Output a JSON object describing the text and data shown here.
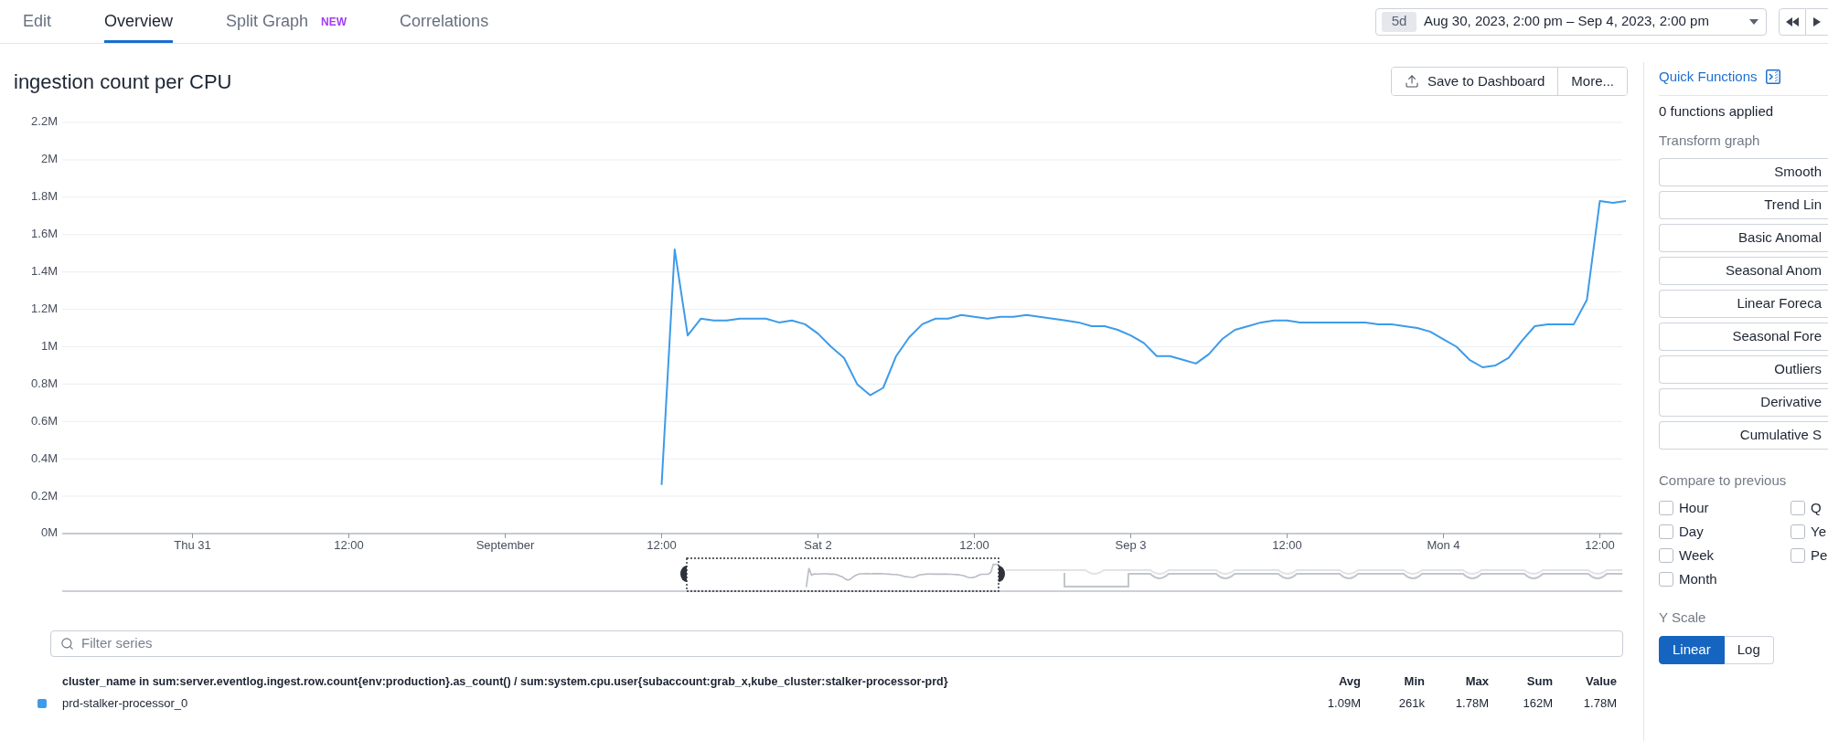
{
  "tabs": [
    {
      "label": "Edit",
      "selected": false
    },
    {
      "label": "Overview",
      "selected": true
    },
    {
      "label": "Split Graph",
      "badge": "NEW",
      "selected": false
    },
    {
      "label": "Correlations",
      "selected": false
    }
  ],
  "time_range": {
    "preset": "5d",
    "label": "Aug 30, 2023, 2:00 pm – Sep 4, 2023, 2:00 pm"
  },
  "graph": {
    "title": "ingestion count per CPU",
    "actions": [
      {
        "label": "Save to Dashboard",
        "kind": "export"
      },
      {
        "label": "More...",
        "kind": "menu"
      }
    ],
    "chart_data": {
      "type": "line",
      "grid": true,
      "ylim": [
        0,
        2.2
      ],
      "categories": [
        null,
        null,
        null,
        null,
        null,
        null,
        null,
        null,
        null,
        null,
        "Thu 31",
        null,
        null,
        null,
        null,
        null,
        null,
        null,
        null,
        null,
        null,
        null,
        "12:00",
        null,
        null,
        null,
        null,
        null,
        null,
        null,
        null,
        null,
        null,
        null,
        "September",
        null,
        null,
        null,
        null,
        null,
        null,
        null,
        null,
        null,
        null,
        null,
        "12:00",
        null,
        null,
        null,
        null,
        null,
        null,
        null,
        null,
        null,
        null,
        null,
        "Sat 2",
        null,
        null,
        null,
        null,
        null,
        null,
        null,
        null,
        null,
        null,
        null,
        "12:00",
        null,
        null,
        null,
        null,
        null,
        null,
        null,
        null,
        null,
        null,
        null,
        "Sep 3",
        null,
        null,
        null,
        null,
        null,
        null,
        null,
        null,
        null,
        null,
        null,
        "12:00",
        null,
        null,
        null,
        null,
        null,
        null,
        null,
        null,
        null,
        null,
        null,
        "Mon 4",
        null,
        null,
        null,
        null,
        null,
        null,
        null,
        null,
        null,
        null,
        null,
        "12:00",
        null,
        null
      ],
      "yticks": [
        {
          "value": 0,
          "label": "0M"
        },
        {
          "value": 0.2,
          "label": "0.2M"
        },
        {
          "value": 0.4,
          "label": "0.4M"
        },
        {
          "value": 0.6,
          "label": "0.6M"
        },
        {
          "value": 0.8,
          "label": "0.8M"
        },
        {
          "value": 1,
          "label": "1M"
        },
        {
          "value": 1.2,
          "label": "1.2M"
        },
        {
          "value": 1.4,
          "label": "1.4M"
        },
        {
          "value": 1.6,
          "label": "1.6M"
        },
        {
          "value": 1.8,
          "label": "1.8M"
        },
        {
          "value": 2,
          "label": "2M"
        },
        {
          "value": 2.2,
          "label": "2.2M"
        }
      ],
      "series": [
        {
          "name": "prd-stalker-processor_0",
          "color": "#3d9be9",
          "values": [
            null,
            null,
            null,
            null,
            null,
            null,
            null,
            null,
            null,
            null,
            null,
            null,
            null,
            null,
            null,
            null,
            null,
            null,
            null,
            null,
            null,
            null,
            null,
            null,
            null,
            null,
            null,
            null,
            null,
            null,
            null,
            null,
            null,
            null,
            null,
            null,
            null,
            null,
            null,
            null,
            null,
            null,
            null,
            null,
            null,
            null,
            0.26,
            1.52,
            1.06,
            1.15,
            1.14,
            1.14,
            1.15,
            1.15,
            1.15,
            1.13,
            1.14,
            1.12,
            1.07,
            1.0,
            0.94,
            0.8,
            0.74,
            0.78,
            0.95,
            1.05,
            1.12,
            1.15,
            1.15,
            1.17,
            1.16,
            1.15,
            1.16,
            1.16,
            1.17,
            1.16,
            1.15,
            1.14,
            1.13,
            1.11,
            1.11,
            1.09,
            1.06,
            1.02,
            0.95,
            0.95,
            0.93,
            0.91,
            0.96,
            1.04,
            1.09,
            1.11,
            1.13,
            1.14,
            1.14,
            1.13,
            1.13,
            1.13,
            1.13,
            1.13,
            1.13,
            1.12,
            1.12,
            1.11,
            1.1,
            1.08,
            1.04,
            1.0,
            0.93,
            0.89,
            0.9,
            0.94,
            1.03,
            1.11,
            1.12,
            1.12,
            1.12,
            1.25,
            1.78,
            1.77,
            1.78
          ]
        }
      ]
    }
  },
  "filter": {
    "placeholder": "Filter series"
  },
  "legend": {
    "query": "cluster_name in sum:server.eventlog.ingest.row.count{env:production}.as_count() / sum:system.cpu.user{subaccount:grab_x,kube_cluster:stalker-processor-prd}",
    "columns": [
      "Avg",
      "Min",
      "Max",
      "Sum",
      "Value"
    ],
    "rows": [
      {
        "color": "#3d9be9",
        "values": [
          "1.09M",
          "261k",
          "1.78M",
          "162M",
          "1.78M"
        ]
      }
    ]
  },
  "quick_functions": {
    "title": "Quick Functions",
    "status": "0 functions applied",
    "transform_label": "Transform graph",
    "transforms": [
      "Smooth",
      "Trend Lin",
      "Basic Anomal",
      "Seasonal Anom",
      "Linear Foreca",
      "Seasonal Fore",
      "Outliers",
      "Derivative",
      "Cumulative S"
    ],
    "compare_label": "Compare to previous",
    "compare": [
      {
        "label": "Hour",
        "checked": false
      },
      {
        "label": "Day",
        "checked": false
      },
      {
        "label": "Week",
        "checked": false
      },
      {
        "label": "Month",
        "checked": false
      },
      {
        "label": "Q",
        "checked": false
      },
      {
        "label": "Ye",
        "checked": false
      },
      {
        "label": "Pe",
        "checked": false
      }
    ],
    "y_scale_label": "Y Scale",
    "y_scale": [
      {
        "label": "Linear",
        "selected": true
      },
      {
        "label": "Log",
        "selected": false
      }
    ]
  }
}
